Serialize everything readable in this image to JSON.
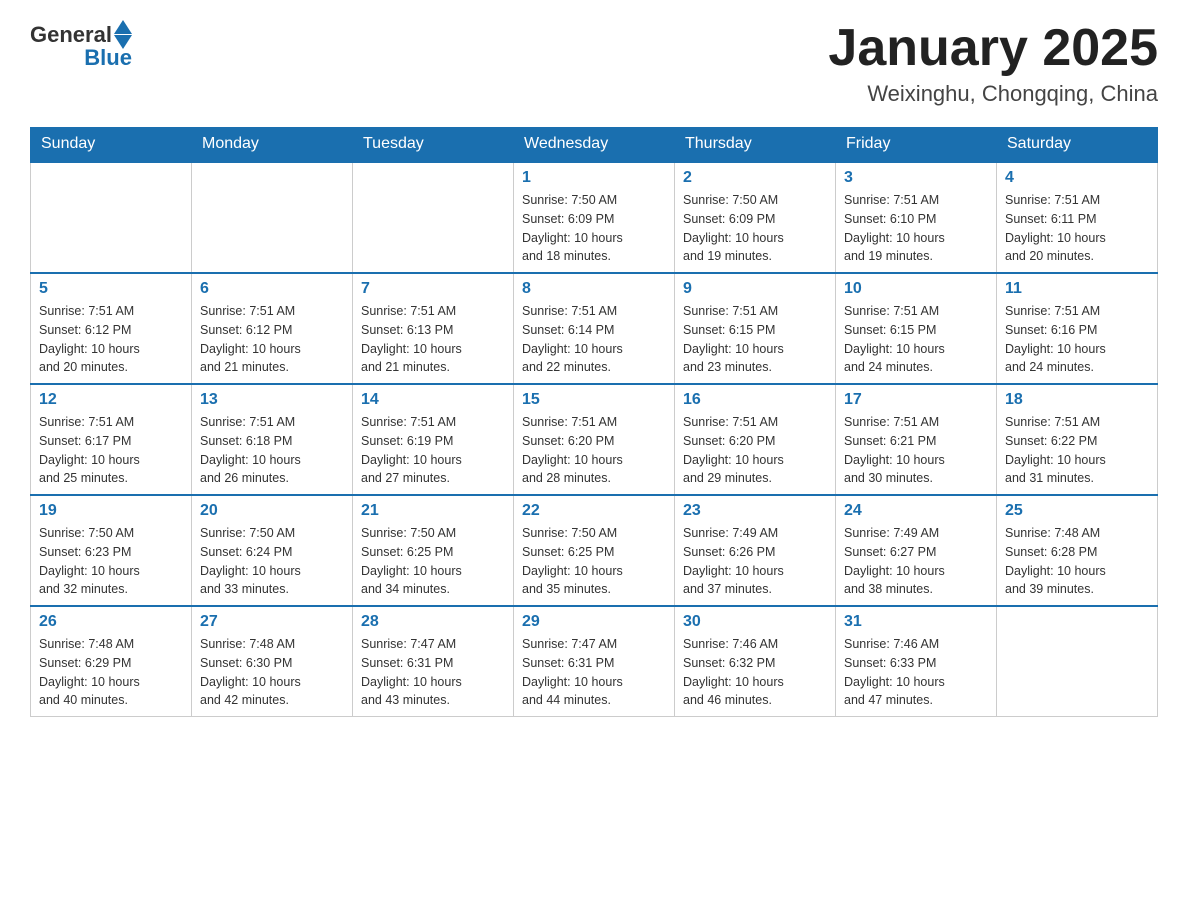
{
  "header": {
    "logo": {
      "general": "General",
      "blue": "Blue"
    },
    "title": "January 2025",
    "location": "Weixinghu, Chongqing, China"
  },
  "days_of_week": [
    "Sunday",
    "Monday",
    "Tuesday",
    "Wednesday",
    "Thursday",
    "Friday",
    "Saturday"
  ],
  "weeks": [
    [
      {
        "day": "",
        "info": ""
      },
      {
        "day": "",
        "info": ""
      },
      {
        "day": "",
        "info": ""
      },
      {
        "day": "1",
        "info": "Sunrise: 7:50 AM\nSunset: 6:09 PM\nDaylight: 10 hours\nand 18 minutes."
      },
      {
        "day": "2",
        "info": "Sunrise: 7:50 AM\nSunset: 6:09 PM\nDaylight: 10 hours\nand 19 minutes."
      },
      {
        "day": "3",
        "info": "Sunrise: 7:51 AM\nSunset: 6:10 PM\nDaylight: 10 hours\nand 19 minutes."
      },
      {
        "day": "4",
        "info": "Sunrise: 7:51 AM\nSunset: 6:11 PM\nDaylight: 10 hours\nand 20 minutes."
      }
    ],
    [
      {
        "day": "5",
        "info": "Sunrise: 7:51 AM\nSunset: 6:12 PM\nDaylight: 10 hours\nand 20 minutes."
      },
      {
        "day": "6",
        "info": "Sunrise: 7:51 AM\nSunset: 6:12 PM\nDaylight: 10 hours\nand 21 minutes."
      },
      {
        "day": "7",
        "info": "Sunrise: 7:51 AM\nSunset: 6:13 PM\nDaylight: 10 hours\nand 21 minutes."
      },
      {
        "day": "8",
        "info": "Sunrise: 7:51 AM\nSunset: 6:14 PM\nDaylight: 10 hours\nand 22 minutes."
      },
      {
        "day": "9",
        "info": "Sunrise: 7:51 AM\nSunset: 6:15 PM\nDaylight: 10 hours\nand 23 minutes."
      },
      {
        "day": "10",
        "info": "Sunrise: 7:51 AM\nSunset: 6:15 PM\nDaylight: 10 hours\nand 24 minutes."
      },
      {
        "day": "11",
        "info": "Sunrise: 7:51 AM\nSunset: 6:16 PM\nDaylight: 10 hours\nand 24 minutes."
      }
    ],
    [
      {
        "day": "12",
        "info": "Sunrise: 7:51 AM\nSunset: 6:17 PM\nDaylight: 10 hours\nand 25 minutes."
      },
      {
        "day": "13",
        "info": "Sunrise: 7:51 AM\nSunset: 6:18 PM\nDaylight: 10 hours\nand 26 minutes."
      },
      {
        "day": "14",
        "info": "Sunrise: 7:51 AM\nSunset: 6:19 PM\nDaylight: 10 hours\nand 27 minutes."
      },
      {
        "day": "15",
        "info": "Sunrise: 7:51 AM\nSunset: 6:20 PM\nDaylight: 10 hours\nand 28 minutes."
      },
      {
        "day": "16",
        "info": "Sunrise: 7:51 AM\nSunset: 6:20 PM\nDaylight: 10 hours\nand 29 minutes."
      },
      {
        "day": "17",
        "info": "Sunrise: 7:51 AM\nSunset: 6:21 PM\nDaylight: 10 hours\nand 30 minutes."
      },
      {
        "day": "18",
        "info": "Sunrise: 7:51 AM\nSunset: 6:22 PM\nDaylight: 10 hours\nand 31 minutes."
      }
    ],
    [
      {
        "day": "19",
        "info": "Sunrise: 7:50 AM\nSunset: 6:23 PM\nDaylight: 10 hours\nand 32 minutes."
      },
      {
        "day": "20",
        "info": "Sunrise: 7:50 AM\nSunset: 6:24 PM\nDaylight: 10 hours\nand 33 minutes."
      },
      {
        "day": "21",
        "info": "Sunrise: 7:50 AM\nSunset: 6:25 PM\nDaylight: 10 hours\nand 34 minutes."
      },
      {
        "day": "22",
        "info": "Sunrise: 7:50 AM\nSunset: 6:25 PM\nDaylight: 10 hours\nand 35 minutes."
      },
      {
        "day": "23",
        "info": "Sunrise: 7:49 AM\nSunset: 6:26 PM\nDaylight: 10 hours\nand 37 minutes."
      },
      {
        "day": "24",
        "info": "Sunrise: 7:49 AM\nSunset: 6:27 PM\nDaylight: 10 hours\nand 38 minutes."
      },
      {
        "day": "25",
        "info": "Sunrise: 7:48 AM\nSunset: 6:28 PM\nDaylight: 10 hours\nand 39 minutes."
      }
    ],
    [
      {
        "day": "26",
        "info": "Sunrise: 7:48 AM\nSunset: 6:29 PM\nDaylight: 10 hours\nand 40 minutes."
      },
      {
        "day": "27",
        "info": "Sunrise: 7:48 AM\nSunset: 6:30 PM\nDaylight: 10 hours\nand 42 minutes."
      },
      {
        "day": "28",
        "info": "Sunrise: 7:47 AM\nSunset: 6:31 PM\nDaylight: 10 hours\nand 43 minutes."
      },
      {
        "day": "29",
        "info": "Sunrise: 7:47 AM\nSunset: 6:31 PM\nDaylight: 10 hours\nand 44 minutes."
      },
      {
        "day": "30",
        "info": "Sunrise: 7:46 AM\nSunset: 6:32 PM\nDaylight: 10 hours\nand 46 minutes."
      },
      {
        "day": "31",
        "info": "Sunrise: 7:46 AM\nSunset: 6:33 PM\nDaylight: 10 hours\nand 47 minutes."
      },
      {
        "day": "",
        "info": ""
      }
    ]
  ]
}
